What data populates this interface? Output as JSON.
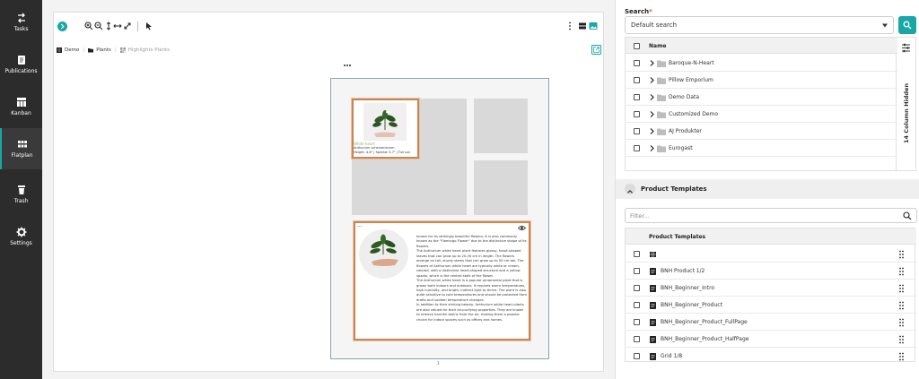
{
  "sidebar": {
    "items": [
      {
        "label": "Tasks",
        "icon": "tasks-icon"
      },
      {
        "label": "Publications",
        "icon": "publications-icon"
      },
      {
        "label": "Kanban",
        "icon": "kanban-icon"
      },
      {
        "label": "Flatplan",
        "icon": "flatplan-icon",
        "active": true
      },
      {
        "label": "Trash",
        "icon": "trash-icon"
      },
      {
        "label": "Settings",
        "icon": "settings-icon"
      }
    ]
  },
  "breadcrumb": {
    "items": [
      "Demo",
      "Plants",
      "Highlights Plants"
    ]
  },
  "page": {
    "card_a": {
      "title": "White heart",
      "subtitle": "Anthurium scherzerianum",
      "size": "Height: 4-6\" | Spread: 5-7\" | Full sun"
    },
    "card_b": {
      "paragraphs": [
        "known for its strikingly beautiful flowers. It is also commonly known as the \"Flamingo Flower\" due to the distinctive shape of its flowers.",
        "The Anthurium white heart plant features glossy, heart-shaped leaves that can grow up to 20-30 cm in length. The flowers emerge on tall, sturdy stems that can grow up to 50 cm tall. The flowers of Anthurium white heart are typically white or cream-colored, with a distinctive heart-shaped structure and a yellow spadix, which is the central stalk of the flower.",
        "The Anthurium white heart is a popular ornamental plant that is grown both indoors and outdoors. It requires warm temperatures, high humidity, and bright, indirect light to thrive. The plant is also quite sensitive to cold temperatures and should be protected from drafts and sudden temperature changes.",
        "In addition to their striking beauty, Anthurium white heart plants are also valued for their air-purifying properties. They are known to remove harmful toxins from the air, making them a popular choice for indoor spaces such as offices and homes."
      ]
    },
    "page_number": "1"
  },
  "search": {
    "label": "Search",
    "required_mark": "*",
    "selected": "Default search"
  },
  "tree_table": {
    "header": "Name",
    "rows": [
      "Baroque-N-Heart",
      "Pillow Emporium",
      "Demo Data",
      "Customized Demo",
      "AJ Produkter",
      "Eurogast"
    ],
    "hidden_columns": "14 Column Hidden"
  },
  "product_templates": {
    "title": "Product Templates",
    "filter_placeholder": "Filter...",
    "header": "Product Templates",
    "rows": [
      {
        "label": "",
        "icon": "grid-icon"
      },
      {
        "label": "BNH Product 1/2",
        "icon": "document-icon"
      },
      {
        "label": "BNH_Beginner_Intro",
        "icon": "document-icon"
      },
      {
        "label": "BNH_Beginner_Product",
        "icon": "document-icon"
      },
      {
        "label": "BNH_Beginner_Product_FullPage",
        "icon": "document-icon"
      },
      {
        "label": "BNH_Beginner_Product_HalfPage",
        "icon": "document-icon"
      },
      {
        "label": "Grid 1/8",
        "icon": "document-icon"
      }
    ]
  },
  "colors": {
    "accent": "#18a7a8",
    "sidebar": "#2c2c2c",
    "selection": "#cc8452"
  }
}
